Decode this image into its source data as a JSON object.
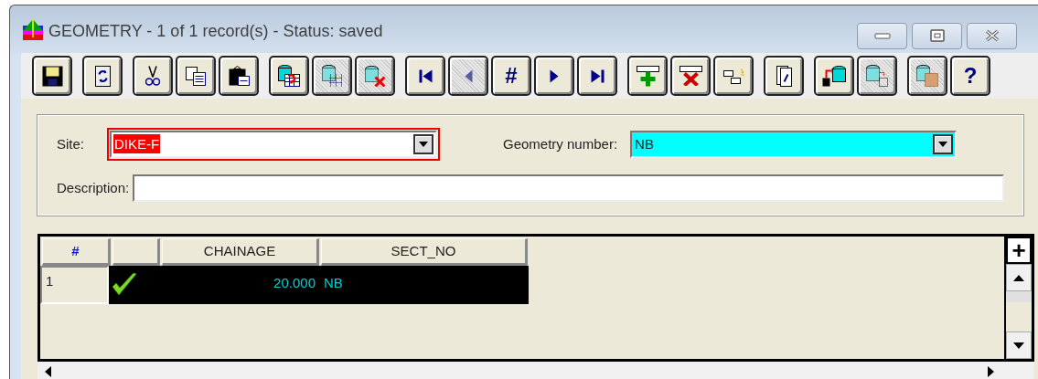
{
  "window": {
    "title": "GEOMETRY - 1 of 1 record(s) - Status: saved"
  },
  "toolbar": [
    [
      {
        "kind": "save",
        "disabled": false
      }
    ],
    [
      {
        "kind": "refresh",
        "disabled": false
      }
    ],
    [
      {
        "kind": "cut",
        "disabled": false
      },
      {
        "kind": "copy",
        "disabled": false
      },
      {
        "kind": "paste",
        "disabled": false
      }
    ],
    [
      {
        "kind": "query",
        "disabled": false
      },
      {
        "kind": "db-query",
        "disabled": true
      },
      {
        "kind": "db-delete",
        "disabled": true
      }
    ],
    [
      {
        "kind": "first",
        "disabled": false
      },
      {
        "kind": "prev",
        "disabled": true
      },
      {
        "kind": "text",
        "label": "#",
        "disabled": false
      },
      {
        "kind": "next",
        "disabled": false
      },
      {
        "kind": "last",
        "disabled": false
      }
    ],
    [
      {
        "kind": "insert",
        "disabled": false
      },
      {
        "kind": "delete",
        "disabled": false
      },
      {
        "kind": "duplicate",
        "disabled": false
      }
    ],
    [
      {
        "kind": "pages",
        "disabled": false
      }
    ],
    [
      {
        "kind": "export",
        "disabled": false
      },
      {
        "kind": "import",
        "disabled": true
      }
    ],
    [
      {
        "kind": "db",
        "disabled": true
      },
      {
        "kind": "text",
        "label": "?",
        "disabled": false
      }
    ]
  ],
  "form": {
    "site": {
      "label": "Site:",
      "value": "DIKE-F",
      "invalid": true,
      "highlighted": false
    },
    "geometry_number": {
      "label": "Geometry number:",
      "value": "NB",
      "invalid": false,
      "highlighted": true
    },
    "description": {
      "label": "Description:"
    }
  },
  "grid": {
    "columns": [
      "#",
      "CHAINAGE",
      "SECT_NO"
    ],
    "corner_button": "+",
    "rows": [
      {
        "number": "1",
        "checked": true,
        "chainage": "20.000",
        "sect_no": "NB",
        "selected": true
      }
    ]
  }
}
